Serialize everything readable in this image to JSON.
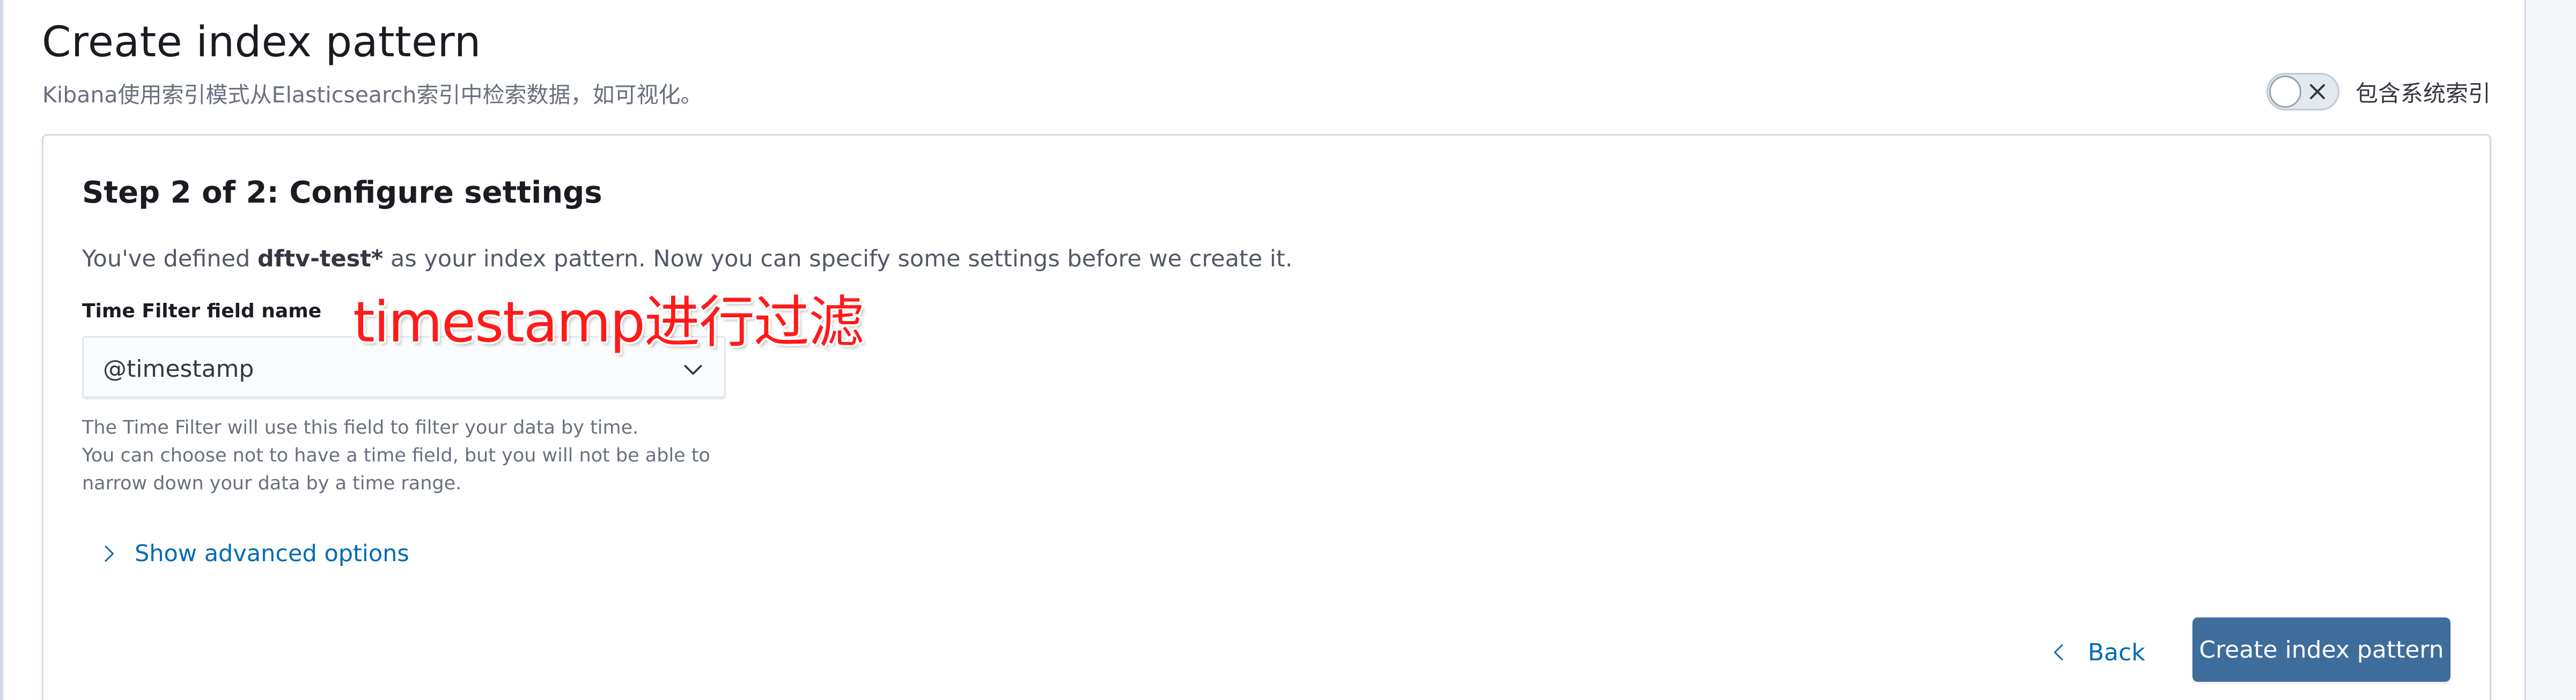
{
  "page": {
    "title": "Create index pattern",
    "subtitle": "Kibana使用索引模式从Elasticsearch索引中检索数据，如可视化。"
  },
  "system_indices_toggle": {
    "label": "包含系统索引",
    "checked": false
  },
  "step": {
    "title": "Step 2 of 2: Configure settings",
    "desc_prefix": "You've defined ",
    "pattern_name": "dftv-test*",
    "desc_suffix": " as your index pattern. Now you can specify some settings before we create it."
  },
  "time_field": {
    "label": "Time Filter field name",
    "value": "@timestamp",
    "help_lines": [
      "The Time Filter will use this field to filter your data by time.",
      "You can choose not to have a time field, but you will not be able to",
      "narrow down your data by a time range."
    ]
  },
  "annotation": {
    "text": "timestamp进行过滤",
    "color": "#ff1a1a"
  },
  "advanced": {
    "label": "Show advanced options"
  },
  "actions": {
    "back_label": "Back",
    "create_label": "Create index pattern"
  },
  "colors": {
    "primary_button": "#3e6d9c",
    "link": "#006bb4"
  }
}
